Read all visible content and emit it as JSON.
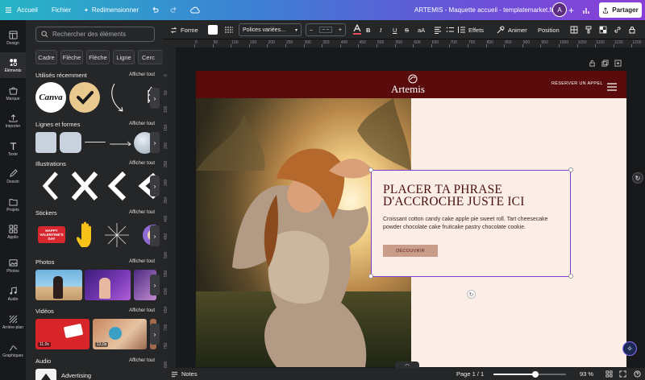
{
  "topbar": {
    "home": "Accueil",
    "file": "Fichier",
    "resize": "Redimensionner",
    "document_title": "ARTEMIS - Maquette accueil - templatemarket.fr",
    "avatar_letter": "A",
    "share": "Partager"
  },
  "rail": {
    "items": [
      {
        "label": "Design",
        "icon": "layout-icon"
      },
      {
        "label": "Éléments",
        "icon": "shapes-icon"
      },
      {
        "label": "Marque",
        "icon": "brand-icon"
      },
      {
        "label": "Importer",
        "icon": "upload-icon"
      },
      {
        "label": "Texte",
        "icon": "text-icon"
      },
      {
        "label": "Dessin",
        "icon": "pen-icon"
      },
      {
        "label": "Projets",
        "icon": "folder-icon"
      },
      {
        "label": "Applis",
        "icon": "apps-icon"
      },
      {
        "label": "Photos",
        "icon": "photo-icon"
      },
      {
        "label": "Audio",
        "icon": "music-icon"
      },
      {
        "label": "Arrière-plan",
        "icon": "background-icon"
      },
      {
        "label": "Graphiques",
        "icon": "chart-icon"
      }
    ]
  },
  "panel": {
    "search_placeholder": "Rechercher des éléments",
    "chips": [
      "Cadre",
      "Flèche",
      "Flèche",
      "Ligne",
      "Cerc"
    ],
    "see_all": "Afficher tout",
    "sections": {
      "recent": "Utilisés récemment",
      "lines": "Lignes et formes",
      "illustrations": "Illustrations",
      "stickers": "Stickers",
      "photos": "Photos",
      "videos": "Vidéos",
      "audio": "Audio"
    },
    "recent_canva_logo": "Canva",
    "sticker_text": "HAPPY VALENTINE'S DAY",
    "video_durations": [
      "11,0s",
      "12,0s"
    ],
    "audio_item": "Advertising"
  },
  "toolbar": {
    "shape": "Forme",
    "font": "Polices variées...",
    "font_size": "– –",
    "minus": "–",
    "plus": "+",
    "text_case": "aA",
    "effects": "Effets",
    "animate": "Animer",
    "position": "Position"
  },
  "ruler": {
    "top": [
      "0",
      "50",
      "100",
      "150",
      "200",
      "250",
      "300",
      "350",
      "400",
      "450",
      "500",
      "550",
      "600",
      "650",
      "700",
      "750",
      "800",
      "850",
      "900",
      "950",
      "1000",
      "1050",
      "1100",
      "1150",
      "1200"
    ],
    "left": [
      "0",
      "50",
      "100",
      "150",
      "200",
      "250",
      "300",
      "350",
      "400",
      "450",
      "500",
      "550",
      "600",
      "650",
      "700",
      "750",
      "800"
    ]
  },
  "design": {
    "logo": "Artemis",
    "nav_cta": "RÉSERVER UN APPEL",
    "headline_line1": "PLACER TA PHRASE",
    "headline_line2": "D'ACCROCHE JUSTE ICI",
    "body": "Croissant cotton candy cake apple pie sweet roll. Tart cheesecake powder chocolate cake fruitcake pastry chocolate cookie.",
    "button": "DÉCOUVRIR",
    "colors": {
      "header_bg": "#5a0b0b",
      "page_bg": "#fbeee6",
      "headline": "#4a1010",
      "button_bg": "#c89d8a",
      "selection": "#7e3dce"
    }
  },
  "bottombar": {
    "notes": "Notes",
    "page": "Page 1 / 1",
    "zoom": "93 %",
    "zoom_level": 0.93
  }
}
